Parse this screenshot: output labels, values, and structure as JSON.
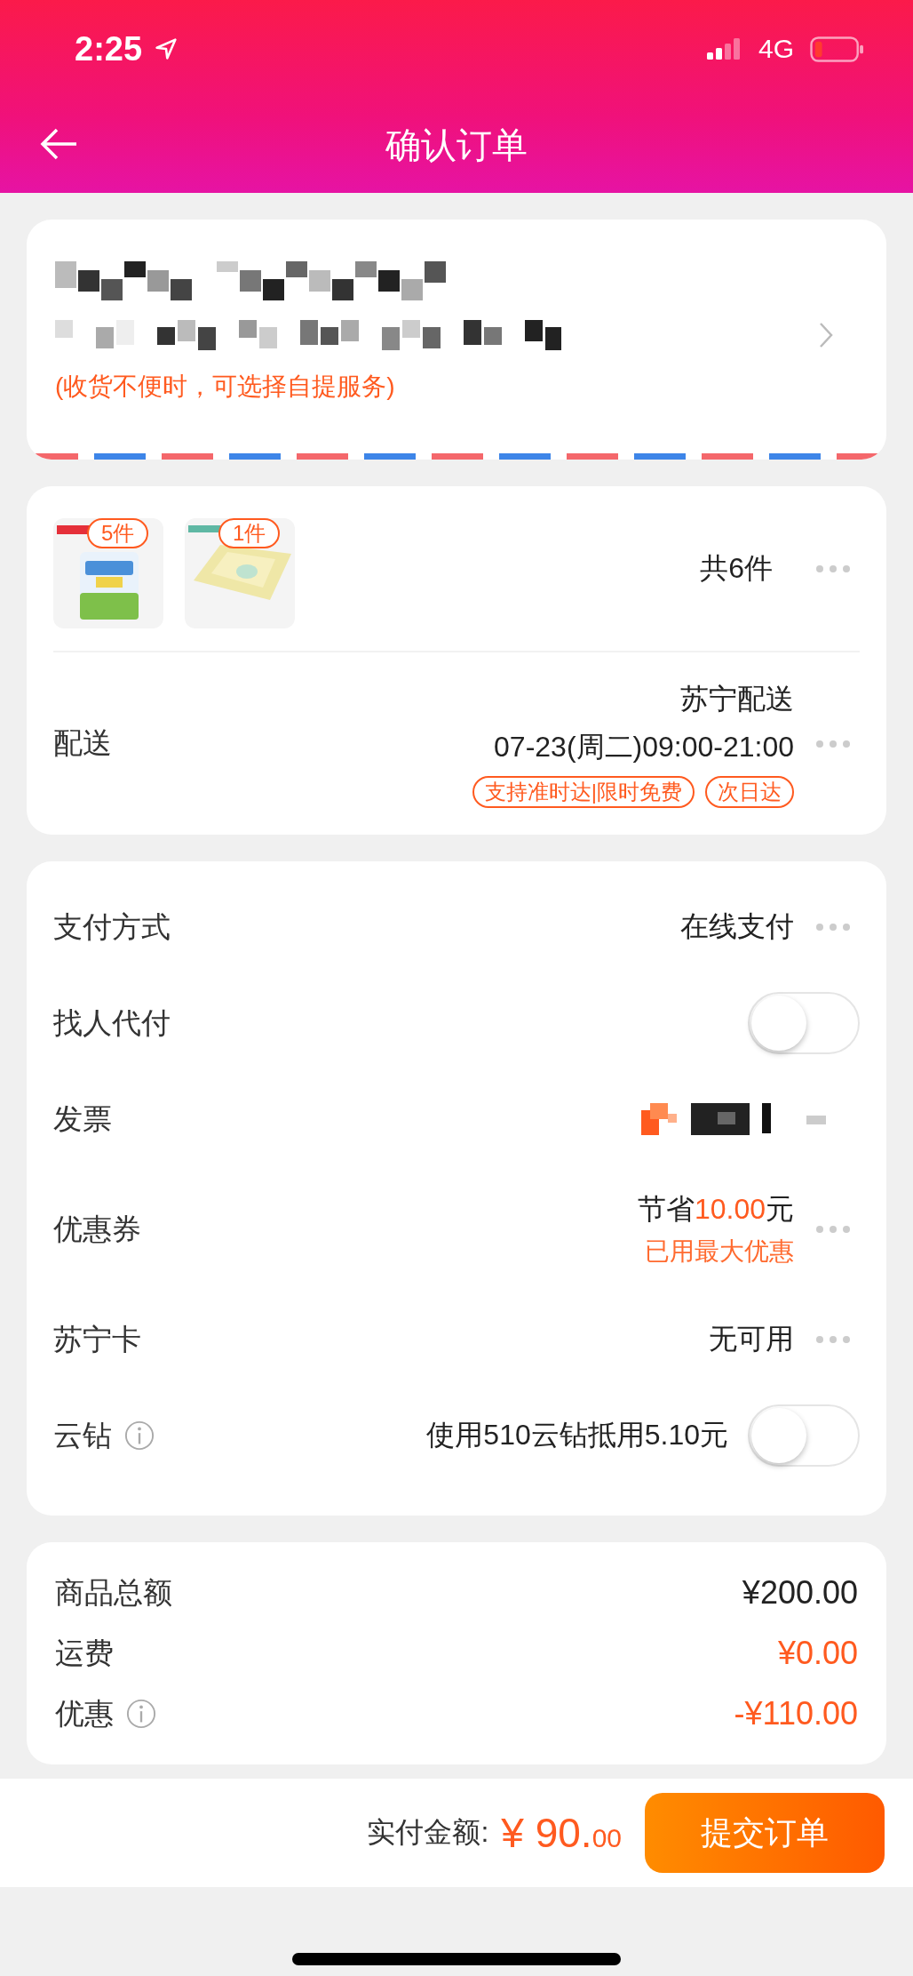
{
  "status_bar": {
    "time": "2:25",
    "network": "4G"
  },
  "header": {
    "title": "确认订单"
  },
  "address": {
    "hint": "(收货不便时，可选择自提服务)"
  },
  "items": {
    "products": [
      {
        "count": "5件"
      },
      {
        "count": "1件"
      }
    ],
    "total": "共6件"
  },
  "delivery": {
    "label": "配送",
    "carrier": "苏宁配送",
    "time": "07-23(周二)09:00-21:00",
    "tags": [
      "支持准时达|限时免费",
      "次日达"
    ]
  },
  "options": [
    {
      "kind": "value",
      "label": "支付方式",
      "value": "在线支付"
    },
    {
      "kind": "toggle",
      "label": "找人代付",
      "on": false
    },
    {
      "kind": "masked",
      "label": "发票"
    },
    {
      "kind": "coupon",
      "label": "优惠券",
      "prefix": "节省",
      "amount": "10.00",
      "suffix": "元",
      "note": "已用最大优惠"
    },
    {
      "kind": "value",
      "label": "苏宁卡",
      "value": "无可用"
    },
    {
      "kind": "toggle",
      "label": "云钻",
      "info": true,
      "value": "使用510云钻抵用5.10元",
      "on": false
    }
  ],
  "summary": [
    {
      "label": "商品总额",
      "value": "¥200.00",
      "highlight": false
    },
    {
      "label": "运费",
      "value": "¥0.00",
      "highlight": true
    },
    {
      "label": "优惠",
      "value": "-¥110.00",
      "info": true,
      "highlight": true
    }
  ],
  "footer": {
    "label": "实付金额:",
    "amount": "¥ 90.",
    "cents": "00",
    "button": "提交订单"
  }
}
